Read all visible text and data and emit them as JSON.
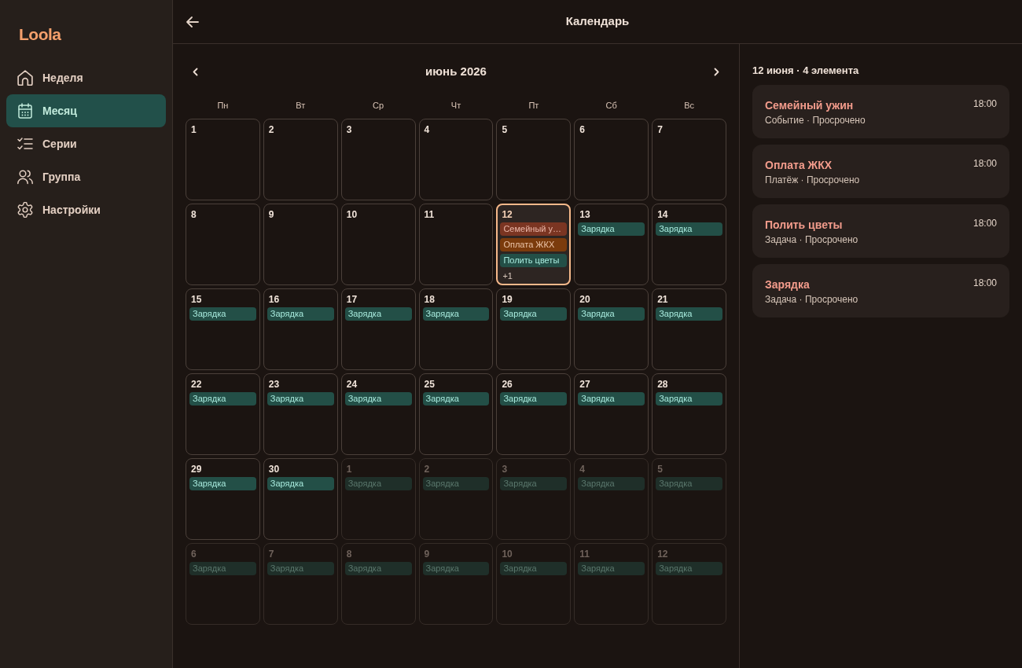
{
  "sidebar": {
    "logo": "Loola",
    "items": [
      {
        "label": "Неделя",
        "selected": false
      },
      {
        "label": "Месяц",
        "selected": true
      },
      {
        "label": "Серии",
        "selected": false
      },
      {
        "label": "Группа",
        "selected": false
      },
      {
        "label": "Настройки",
        "selected": false
      }
    ]
  },
  "header": {
    "title": "Календарь"
  },
  "calendar": {
    "month_label": "июнь 2026",
    "weekdays": [
      "Пн",
      "Вт",
      "Ср",
      "Чт",
      "Пт",
      "Сб",
      "Вс"
    ],
    "weeks": [
      [
        {
          "day": "1",
          "outside_month": false,
          "selected": false
        },
        {
          "day": "2",
          "outside_month": false,
          "selected": false
        },
        {
          "day": "3",
          "outside_month": false,
          "selected": false
        },
        {
          "day": "4",
          "outside_month": false,
          "selected": false
        },
        {
          "day": "5",
          "outside_month": false,
          "selected": false
        },
        {
          "day": "6",
          "outside_month": false,
          "selected": false
        },
        {
          "day": "7",
          "outside_month": false,
          "selected": false
        }
      ],
      [
        {
          "day": "8",
          "outside_month": false,
          "selected": false
        },
        {
          "day": "9",
          "outside_month": false,
          "selected": false
        },
        {
          "day": "10",
          "outside_month": false,
          "selected": false
        },
        {
          "day": "11",
          "outside_month": false,
          "selected": false
        },
        {
          "day": "12",
          "outside_month": false,
          "selected": true,
          "events": [
            {
              "title": "Семейный у…",
              "color": "#7a3522"
            },
            {
              "title": "Оплата ЖКХ",
              "color": "#7b3b0c"
            },
            {
              "title": "Полить цветы",
              "color": "#234f47"
            }
          ],
          "more": "+1"
        },
        {
          "day": "13",
          "outside_month": false,
          "selected": false,
          "events": [
            {
              "title": "Зарядка",
              "color": "#234f47"
            }
          ]
        },
        {
          "day": "14",
          "outside_month": false,
          "selected": false,
          "events": [
            {
              "title": "Зарядка",
              "color": "#234f47"
            }
          ]
        }
      ],
      [
        {
          "day": "15",
          "outside_month": false,
          "selected": false,
          "events": [
            {
              "title": "Зарядка",
              "color": "#234f47"
            }
          ]
        },
        {
          "day": "16",
          "outside_month": false,
          "selected": false,
          "events": [
            {
              "title": "Зарядка",
              "color": "#234f47"
            }
          ]
        },
        {
          "day": "17",
          "outside_month": false,
          "selected": false,
          "events": [
            {
              "title": "Зарядка",
              "color": "#234f47"
            }
          ]
        },
        {
          "day": "18",
          "outside_month": false,
          "selected": false,
          "events": [
            {
              "title": "Зарядка",
              "color": "#234f47"
            }
          ]
        },
        {
          "day": "19",
          "outside_month": false,
          "selected": false,
          "events": [
            {
              "title": "Зарядка",
              "color": "#234f47"
            }
          ]
        },
        {
          "day": "20",
          "outside_month": false,
          "selected": false,
          "events": [
            {
              "title": "Зарядка",
              "color": "#234f47"
            }
          ]
        },
        {
          "day": "21",
          "outside_month": false,
          "selected": false,
          "events": [
            {
              "title": "Зарядка",
              "color": "#234f47"
            }
          ]
        }
      ],
      [
        {
          "day": "22",
          "outside_month": false,
          "selected": false,
          "events": [
            {
              "title": "Зарядка",
              "color": "#234f47"
            }
          ]
        },
        {
          "day": "23",
          "outside_month": false,
          "selected": false,
          "events": [
            {
              "title": "Зарядка",
              "color": "#234f47"
            }
          ]
        },
        {
          "day": "24",
          "outside_month": false,
          "selected": false,
          "events": [
            {
              "title": "Зарядка",
              "color": "#234f47"
            }
          ]
        },
        {
          "day": "25",
          "outside_month": false,
          "selected": false,
          "events": [
            {
              "title": "Зарядка",
              "color": "#234f47"
            }
          ]
        },
        {
          "day": "26",
          "outside_month": false,
          "selected": false,
          "events": [
            {
              "title": "Зарядка",
              "color": "#234f47"
            }
          ]
        },
        {
          "day": "27",
          "outside_month": false,
          "selected": false,
          "events": [
            {
              "title": "Зарядка",
              "color": "#234f47"
            }
          ]
        },
        {
          "day": "28",
          "outside_month": false,
          "selected": false,
          "events": [
            {
              "title": "Зарядка",
              "color": "#234f47"
            }
          ]
        }
      ],
      [
        {
          "day": "29",
          "outside_month": false,
          "selected": false,
          "events": [
            {
              "title": "Зарядка",
              "color": "#234f47"
            }
          ]
        },
        {
          "day": "30",
          "outside_month": false,
          "selected": false,
          "events": [
            {
              "title": "Зарядка",
              "color": "#234f47"
            }
          ]
        },
        {
          "day": "1",
          "outside_month": true,
          "selected": false,
          "events": [
            {
              "title": "Зарядка",
              "color": "#1f2f29"
            }
          ]
        },
        {
          "day": "2",
          "outside_month": true,
          "selected": false,
          "events": [
            {
              "title": "Зарядка",
              "color": "#1f2f29"
            }
          ]
        },
        {
          "day": "3",
          "outside_month": true,
          "selected": false,
          "events": [
            {
              "title": "Зарядка",
              "color": "#1f2f29"
            }
          ]
        },
        {
          "day": "4",
          "outside_month": true,
          "selected": false,
          "events": [
            {
              "title": "Зарядка",
              "color": "#1f2f29"
            }
          ]
        },
        {
          "day": "5",
          "outside_month": true,
          "selected": false,
          "events": [
            {
              "title": "Зарядка",
              "color": "#1f2f29"
            }
          ]
        }
      ],
      [
        {
          "day": "6",
          "outside_month": true,
          "selected": false,
          "events": [
            {
              "title": "Зарядка",
              "color": "#1f2f29"
            }
          ]
        },
        {
          "day": "7",
          "outside_month": true,
          "selected": false,
          "events": [
            {
              "title": "Зарядка",
              "color": "#1f2f29"
            }
          ]
        },
        {
          "day": "8",
          "outside_month": true,
          "selected": false,
          "events": [
            {
              "title": "Зарядка",
              "color": "#1f2f29"
            }
          ]
        },
        {
          "day": "9",
          "outside_month": true,
          "selected": false,
          "events": [
            {
              "title": "Зарядка",
              "color": "#1f2f29"
            }
          ]
        },
        {
          "day": "10",
          "outside_month": true,
          "selected": false,
          "events": [
            {
              "title": "Зарядка",
              "color": "#1f2f29"
            }
          ]
        },
        {
          "day": "11",
          "outside_month": true,
          "selected": false,
          "events": [
            {
              "title": "Зарядка",
              "color": "#1f2f29"
            }
          ]
        },
        {
          "day": "12",
          "outside_month": true,
          "selected": false,
          "events": [
            {
              "title": "Зарядка",
              "color": "#1f2f29"
            }
          ]
        }
      ]
    ]
  },
  "agenda": {
    "heading": "12 июня · 4 элемента",
    "items": [
      {
        "title": "Семейный ужин",
        "meta": "Событие · Просрочено",
        "time": "18:00"
      },
      {
        "title": "Оплата ЖКХ",
        "meta": "Платёж · Просрочено",
        "time": "18:00"
      },
      {
        "title": "Полить цветы",
        "meta": "Задача · Просрочено",
        "time": "18:00"
      },
      {
        "title": "Зарядка",
        "meta": "Задача · Просрочено",
        "time": "18:00"
      }
    ]
  }
}
